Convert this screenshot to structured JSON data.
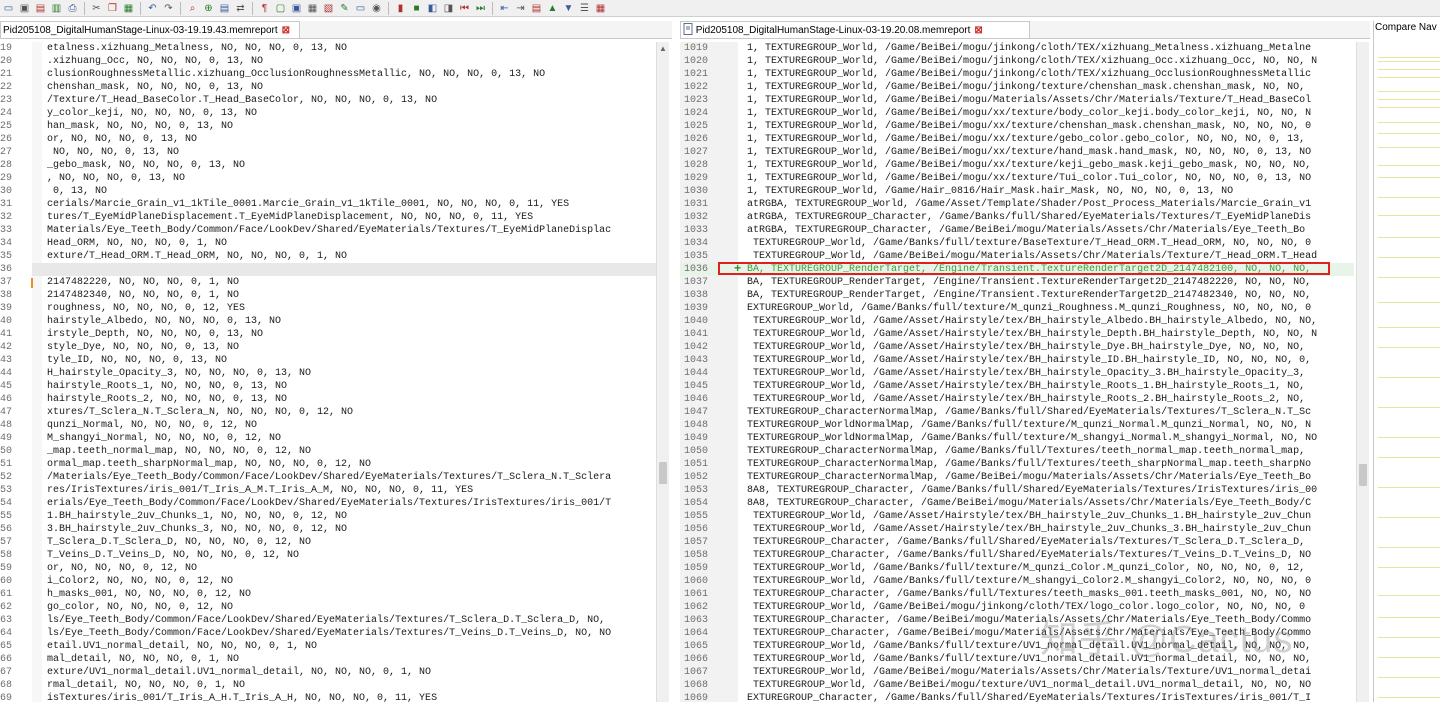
{
  "toolbar": {
    "icons": [
      "new-icon",
      "save-icon",
      "save-all-icon",
      "print-preview-icon",
      "print-icon",
      "cut-icon",
      "copy-icon",
      "paste-icon",
      "undo-icon",
      "redo-icon",
      "find-icon",
      "zoom-icon",
      "compare-icon",
      "sync-icon",
      "whitespace-icon",
      "folder-icon",
      "options-icon",
      "report-icon",
      "clipboard-icon",
      "edit-icon",
      "hide-icon",
      "eye-icon",
      "bookmark-icon",
      "stop-icon",
      "prev-icon",
      "next-icon",
      "first-icon",
      "last-icon",
      "merge-left-icon",
      "merge-right-icon",
      "view-icon",
      "up-icon",
      "down-icon",
      "filter-icon",
      "layout-icon"
    ]
  },
  "tabs": {
    "left": "Pid205108_DigitalHumanStage-Linux-03-19.19.43.memreport",
    "right": "Pid205108_DigitalHumanStage-Linux-03-19.20.08.memreport",
    "close": "⊠"
  },
  "compare_panel": {
    "title": "Compare Nav"
  },
  "watermark": "知乎 @Cactus",
  "left": {
    "lines": [
      {
        "n": "19",
        "t": "etalness.xizhuang_Metalness, NO, NO, NO, 0, 13, NO"
      },
      {
        "n": "20",
        "t": ".xizhuang_Occ, NO, NO, NO, 0, 13, NO"
      },
      {
        "n": "21",
        "t": "clusionRoughnessMetallic.xizhuang_OcclusionRoughnessMetallic, NO, NO, NO, 0, 13, NO"
      },
      {
        "n": "22",
        "t": "chenshan_mask, NO, NO, NO, 0, 13, NO"
      },
      {
        "n": "23",
        "t": "/Texture/T_Head_BaseColor.T_Head_BaseColor, NO, NO, NO, 0, 13, NO"
      },
      {
        "n": "24",
        "t": "y_color_keji, NO, NO, NO, 0, 13, NO"
      },
      {
        "n": "25",
        "t": "han_mask, NO, NO, NO, 0, 13, NO"
      },
      {
        "n": "26",
        "t": "or, NO, NO, NO, 0, 13, NO"
      },
      {
        "n": "27",
        "t": " NO, NO, NO, 0, 13, NO"
      },
      {
        "n": "28",
        "t": "_gebo_mask, NO, NO, NO, 0, 13, NO"
      },
      {
        "n": "29",
        "t": ", NO, NO, NO, 0, 13, NO"
      },
      {
        "n": "30",
        "t": " 0, 13, NO"
      },
      {
        "n": "31",
        "t": "cerials/Marcie_Grain_v1_1kTile_0001.Marcie_Grain_v1_1kTile_0001, NO, NO, NO, 0, 11, YES"
      },
      {
        "n": "32",
        "t": "tures/T_EyeMidPlaneDisplacement.T_EyeMidPlaneDisplacement, NO, NO, NO, 0, 11, YES"
      },
      {
        "n": "33",
        "t": "Materials/Eye_Teeth_Body/Common/Face/LookDev/Shared/EyeMaterials/Textures/T_EyeMidPlaneDisplac"
      },
      {
        "n": "34",
        "t": "Head_ORM, NO, NO, NO, 0, 1, NO"
      },
      {
        "n": "35",
        "t": "exture/T_Head_ORM.T_Head_ORM, NO, NO, NO, 0, 1, NO"
      },
      {
        "n": "36",
        "t": ""
      },
      {
        "n": "37",
        "t": "2147482220, NO, NO, NO, 0, 1, NO"
      },
      {
        "n": "38",
        "t": "2147482340, NO, NO, NO, 0, 1, NO"
      },
      {
        "n": "39",
        "t": "roughness, NO, NO, NO, 0, 12, YES"
      },
      {
        "n": "40",
        "t": "hairstyle_Albedo, NO, NO, NO, 0, 13, NO"
      },
      {
        "n": "41",
        "t": "irstyle_Depth, NO, NO, NO, 0, 13, NO"
      },
      {
        "n": "42",
        "t": "style_Dye, NO, NO, NO, 0, 13, NO"
      },
      {
        "n": "43",
        "t": "tyle_ID, NO, NO, NO, 0, 13, NO"
      },
      {
        "n": "44",
        "t": "H_hairstyle_Opacity_3, NO, NO, NO, 0, 13, NO"
      },
      {
        "n": "45",
        "t": "hairstyle_Roots_1, NO, NO, NO, 0, 13, NO"
      },
      {
        "n": "46",
        "t": "hairstyle_Roots_2, NO, NO, NO, 0, 13, NO"
      },
      {
        "n": "47",
        "t": "xtures/T_Sclera_N.T_Sclera_N, NO, NO, NO, 0, 12, NO"
      },
      {
        "n": "48",
        "t": "qunzi_Normal, NO, NO, NO, 0, 12, NO"
      },
      {
        "n": "49",
        "t": "M_shangyi_Normal, NO, NO, NO, 0, 12, NO"
      },
      {
        "n": "50",
        "t": "_map.teeth_normal_map, NO, NO, NO, 0, 12, NO"
      },
      {
        "n": "51",
        "t": "ormal_map.teeth_sharpNormal_map, NO, NO, NO, 0, 12, NO"
      },
      {
        "n": "52",
        "t": "/Materials/Eye_Teeth_Body/Common/Face/LookDev/Shared/EyeMaterials/Textures/T_Sclera_N.T_Sclera"
      },
      {
        "n": "53",
        "t": "res/IrisTextures/iris_001/T_Iris_A_M.T_Iris_A_M, NO, NO, NO, 0, 11, YES"
      },
      {
        "n": "54",
        "t": "erials/Eye_Teeth_Body/Common/Face/LookDev/Shared/EyeMaterials/Textures/IrisTextures/iris_001/T"
      },
      {
        "n": "55",
        "t": "1.BH_hairstyle_2uv_Chunks_1, NO, NO, NO, 0, 12, NO"
      },
      {
        "n": "56",
        "t": "3.BH_hairstyle_2uv_Chunks_3, NO, NO, NO, 0, 12, NO"
      },
      {
        "n": "57",
        "t": "T_Sclera_D.T_Sclera_D, NO, NO, NO, 0, 12, NO"
      },
      {
        "n": "58",
        "t": "T_Veins_D.T_Veins_D, NO, NO, NO, 0, 12, NO"
      },
      {
        "n": "59",
        "t": "or, NO, NO, NO, 0, 12, NO"
      },
      {
        "n": "60",
        "t": "i_Color2, NO, NO, NO, 0, 12, NO"
      },
      {
        "n": "61",
        "t": "h_masks_001, NO, NO, NO, 0, 12, NO"
      },
      {
        "n": "62",
        "t": "go_color, NO, NO, NO, 0, 12, NO"
      },
      {
        "n": "63",
        "t": "ls/Eye_Teeth_Body/Common/Face/LookDev/Shared/EyeMaterials/Textures/T_Sclera_D.T_Sclera_D, NO,"
      },
      {
        "n": "64",
        "t": "ls/Eye_Teeth_Body/Common/Face/LookDev/Shared/EyeMaterials/Textures/T_Veins_D.T_Veins_D, NO, NO"
      },
      {
        "n": "65",
        "t": "etail.UV1_normal_detail, NO, NO, NO, 0, 1, NO"
      },
      {
        "n": "66",
        "t": "mal_detail, NO, NO, NO, 0, 1, NO"
      },
      {
        "n": "67",
        "t": "exture/UV1_normal_detail.UV1_normal_detail, NO, NO, NO, 0, 1, NO"
      },
      {
        "n": "68",
        "t": "rmal_detail, NO, NO, NO, 0, 1, NO"
      },
      {
        "n": "69",
        "t": "isTextures/iris_001/T_Iris_A_H.T_Iris_A_H, NO, NO, NO, 0, 11, YES"
      }
    ]
  },
  "right": {
    "lines": [
      {
        "n": "1019",
        "t": "1, TEXTUREGROUP_World, /Game/BeiBei/mogu/jinkong/cloth/TEX/xizhuang_Metalness.xizhuang_Metalne"
      },
      {
        "n": "1020",
        "t": "1, TEXTUREGROUP_World, /Game/BeiBei/mogu/jinkong/cloth/TEX/xizhuang_Occ.xizhuang_Occ, NO, NO, N"
      },
      {
        "n": "1021",
        "t": "1, TEXTUREGROUP_World, /Game/BeiBei/mogu/jinkong/cloth/TEX/xizhuang_OcclusionRoughnessMetallic"
      },
      {
        "n": "1022",
        "t": "1, TEXTUREGROUP_World, /Game/BeiBei/mogu/jinkong/texture/chenshan_mask.chenshan_mask, NO, NO,"
      },
      {
        "n": "1023",
        "t": "1, TEXTUREGROUP_World, /Game/BeiBei/mogu/Materials/Assets/Chr/Materials/Texture/T_Head_BaseCol"
      },
      {
        "n": "1024",
        "t": "1, TEXTUREGROUP_World, /Game/BeiBei/mogu/xx/texture/body_color_keji.body_color_keji, NO, NO, N"
      },
      {
        "n": "1025",
        "t": "1, TEXTUREGROUP_World, /Game/BeiBei/mogu/xx/texture/chenshan_mask.chenshan_mask, NO, NO, NO, 0"
      },
      {
        "n": "1026",
        "t": "1, TEXTUREGROUP_World, /Game/BeiBei/mogu/xx/texture/gebo_color.gebo_color, NO, NO, NO, 0, 13,"
      },
      {
        "n": "1027",
        "t": "1, TEXTUREGROUP_World, /Game/BeiBei/mogu/xx/texture/hand_mask.hand_mask, NO, NO, NO, 0, 13, NO"
      },
      {
        "n": "1028",
        "t": "1, TEXTUREGROUP_World, /Game/BeiBei/mogu/xx/texture/keji_gebo_mask.keji_gebo_mask, NO, NO, NO,"
      },
      {
        "n": "1029",
        "t": "1, TEXTUREGROUP_World, /Game/BeiBei/mogu/xx/texture/Tui_color.Tui_color, NO, NO, NO, 0, 13, NO"
      },
      {
        "n": "1030",
        "t": "1, TEXTUREGROUP_World, /Game/Hair_0816/Hair_Mask.hair_Mask, NO, NO, NO, 0, 13, NO"
      },
      {
        "n": "1031",
        "t": "atRGBA, TEXTUREGROUP_World, /Game/Asset/Template/Shader/Post_Process_Materials/Marcie_Grain_v1"
      },
      {
        "n": "1032",
        "t": "atRGBA, TEXTUREGROUP_Character, /Game/Banks/full/Shared/EyeMaterials/Textures/T_EyeMidPlaneDis"
      },
      {
        "n": "1033",
        "t": "atRGBA, TEXTUREGROUP_Character, /Game/BeiBei/mogu/Materials/Assets/Chr/Materials/Eye_Teeth_Bo"
      },
      {
        "n": "1034",
        "t": " TEXTUREGROUP_World, /Game/Banks/full/texture/BaseTexture/T_Head_ORM.T_Head_ORM, NO, NO, NO, 0"
      },
      {
        "n": "1035",
        "t": " TEXTUREGROUP_World, /Game/BeiBei/mogu/Materials/Assets/Chr/Materials/Texture/T_Head_ORM.T_Head"
      },
      {
        "n": "1036",
        "t": "BA, TEXTUREGROUP_RenderTarget, /Engine/Transient.TextureRenderTarget2D_2147482100, NO, NO, NO,",
        "hl": true
      },
      {
        "n": "1037",
        "t": "BA, TEXTUREGROUP_RenderTarget, /Engine/Transient.TextureRenderTarget2D_2147482220, NO, NO, NO,"
      },
      {
        "n": "1038",
        "t": "BA, TEXTUREGROUP_RenderTarget, /Engine/Transient.TextureRenderTarget2D_2147482340, NO, NO, NO,"
      },
      {
        "n": "1039",
        "t": "EXTUREGROUP_World, /Game/Banks/full/texture/M_qunzi_Roughness.M_qunzi_Roughness, NO, NO, NO, 0"
      },
      {
        "n": "1040",
        "t": " TEXTUREGROUP_World, /Game/Asset/Hairstyle/tex/BH_hairstyle_Albedo.BH_hairstyle_Albedo, NO, NO,"
      },
      {
        "n": "1041",
        "t": " TEXTUREGROUP_World, /Game/Asset/Hairstyle/tex/BH_hairstyle_Depth.BH_hairstyle_Depth, NO, NO, N"
      },
      {
        "n": "1042",
        "t": " TEXTUREGROUP_World, /Game/Asset/Hairstyle/tex/BH_hairstyle_Dye.BH_hairstyle_Dye, NO, NO, NO,"
      },
      {
        "n": "1043",
        "t": " TEXTUREGROUP_World, /Game/Asset/Hairstyle/tex/BH_hairstyle_ID.BH_hairstyle_ID, NO, NO, NO, 0,"
      },
      {
        "n": "1044",
        "t": " TEXTUREGROUP_World, /Game/Asset/Hairstyle/tex/BH_hairstyle_Opacity_3.BH_hairstyle_Opacity_3,"
      },
      {
        "n": "1045",
        "t": " TEXTUREGROUP_World, /Game/Asset/Hairstyle/tex/BH_hairstyle_Roots_1.BH_hairstyle_Roots_1, NO,"
      },
      {
        "n": "1046",
        "t": " TEXTUREGROUP_World, /Game/Asset/Hairstyle/tex/BH_hairstyle_Roots_2.BH_hairstyle_Roots_2, NO,"
      },
      {
        "n": "1047",
        "t": "TEXTUREGROUP_CharacterNormalMap, /Game/Banks/full/Shared/EyeMaterials/Textures/T_Sclera_N.T_Sc"
      },
      {
        "n": "1048",
        "t": "TEXTUREGROUP_WorldNormalMap, /Game/Banks/full/texture/M_qunzi_Normal.M_qunzi_Normal, NO, NO, N"
      },
      {
        "n": "1049",
        "t": "TEXTUREGROUP_WorldNormalMap, /Game/Banks/full/texture/M_shangyi_Normal.M_shangyi_Normal, NO, NO"
      },
      {
        "n": "1050",
        "t": "TEXTUREGROUP_CharacterNormalMap, /Game/Banks/full/Textures/teeth_normal_map.teeth_normal_map,"
      },
      {
        "n": "1051",
        "t": "TEXTUREGROUP_CharacterNormalMap, /Game/Banks/full/Textures/teeth_sharpNormal_map.teeth_sharpNo"
      },
      {
        "n": "1052",
        "t": "TEXTUREGROUP_CharacterNormalMap, /Game/BeiBei/mogu/Materials/Assets/Chr/Materials/Eye_Teeth_Bo"
      },
      {
        "n": "1053",
        "t": "8A8, TEXTUREGROUP_Character, /Game/Banks/full/Shared/EyeMaterials/Textures/IrisTextures/iris_00"
      },
      {
        "n": "1054",
        "t": "8A8, TEXTUREGROUP_Character, /Game/BeiBei/mogu/Materials/Assets/Chr/Materials/Eye_Teeth_Body/C"
      },
      {
        "n": "1055",
        "t": " TEXTUREGROUP_World, /Game/Asset/Hairstyle/tex/BH_hairstyle_2uv_Chunks_1.BH_hairstyle_2uv_Chun"
      },
      {
        "n": "1056",
        "t": " TEXTUREGROUP_World, /Game/Asset/Hairstyle/tex/BH_hairstyle_2uv_Chunks_3.BH_hairstyle_2uv_Chun"
      },
      {
        "n": "1057",
        "t": " TEXTUREGROUP_Character, /Game/Banks/full/Shared/EyeMaterials/Textures/T_Sclera_D.T_Sclera_D,"
      },
      {
        "n": "1058",
        "t": " TEXTUREGROUP_Character, /Game/Banks/full/Shared/EyeMaterials/Textures/T_Veins_D.T_Veins_D, NO"
      },
      {
        "n": "1059",
        "t": " TEXTUREGROUP_World, /Game/Banks/full/texture/M_qunzi_Color.M_qunzi_Color, NO, NO, NO, 0, 12,"
      },
      {
        "n": "1060",
        "t": " TEXTUREGROUP_World, /Game/Banks/full/texture/M_shangyi_Color2.M_shangyi_Color2, NO, NO, NO, 0"
      },
      {
        "n": "1061",
        "t": " TEXTUREGROUP_Character, /Game/Banks/full/Textures/teeth_masks_001.teeth_masks_001, NO, NO, NO"
      },
      {
        "n": "1062",
        "t": " TEXTUREGROUP_World, /Game/BeiBei/mogu/jinkong/cloth/TEX/logo_color.logo_color, NO, NO, NO, 0"
      },
      {
        "n": "1063",
        "t": " TEXTUREGROUP_Character, /Game/BeiBei/mogu/Materials/Assets/Chr/Materials/Eye_Teeth_Body/Commo"
      },
      {
        "n": "1064",
        "t": " TEXTUREGROUP_Character, /Game/BeiBei/mogu/Materials/Assets/Chr/Materials/Eye_Teeth_Body/Commo"
      },
      {
        "n": "1065",
        "t": " TEXTUREGROUP_World, /Game/Banks/full/texture/UV1_normal_detail.UV1_normal_detail, NO, NO, NO,"
      },
      {
        "n": "1066",
        "t": " TEXTUREGROUP_World, /Game/Banks/full/texture/UV1_normal_detail.UV1_normal_detail, NO, NO, NO,"
      },
      {
        "n": "1067",
        "t": " TEXTUREGROUP_World, /Game/BeiBei/mogu/Materials/Assets/Chr/Materials/Texture/UV1_normal_detai"
      },
      {
        "n": "1068",
        "t": " TEXTUREGROUP_World, /Game/BeiBei/mogu/texture/UV1_normal_detail.UV1_normal_detail, NO, NO, NO"
      },
      {
        "n": "1069",
        "t": "EXTUREGROUP_Character, /Game/Banks/full/Shared/EyeMaterials/Textures/IrisTextures/iris_001/T_I"
      }
    ]
  }
}
